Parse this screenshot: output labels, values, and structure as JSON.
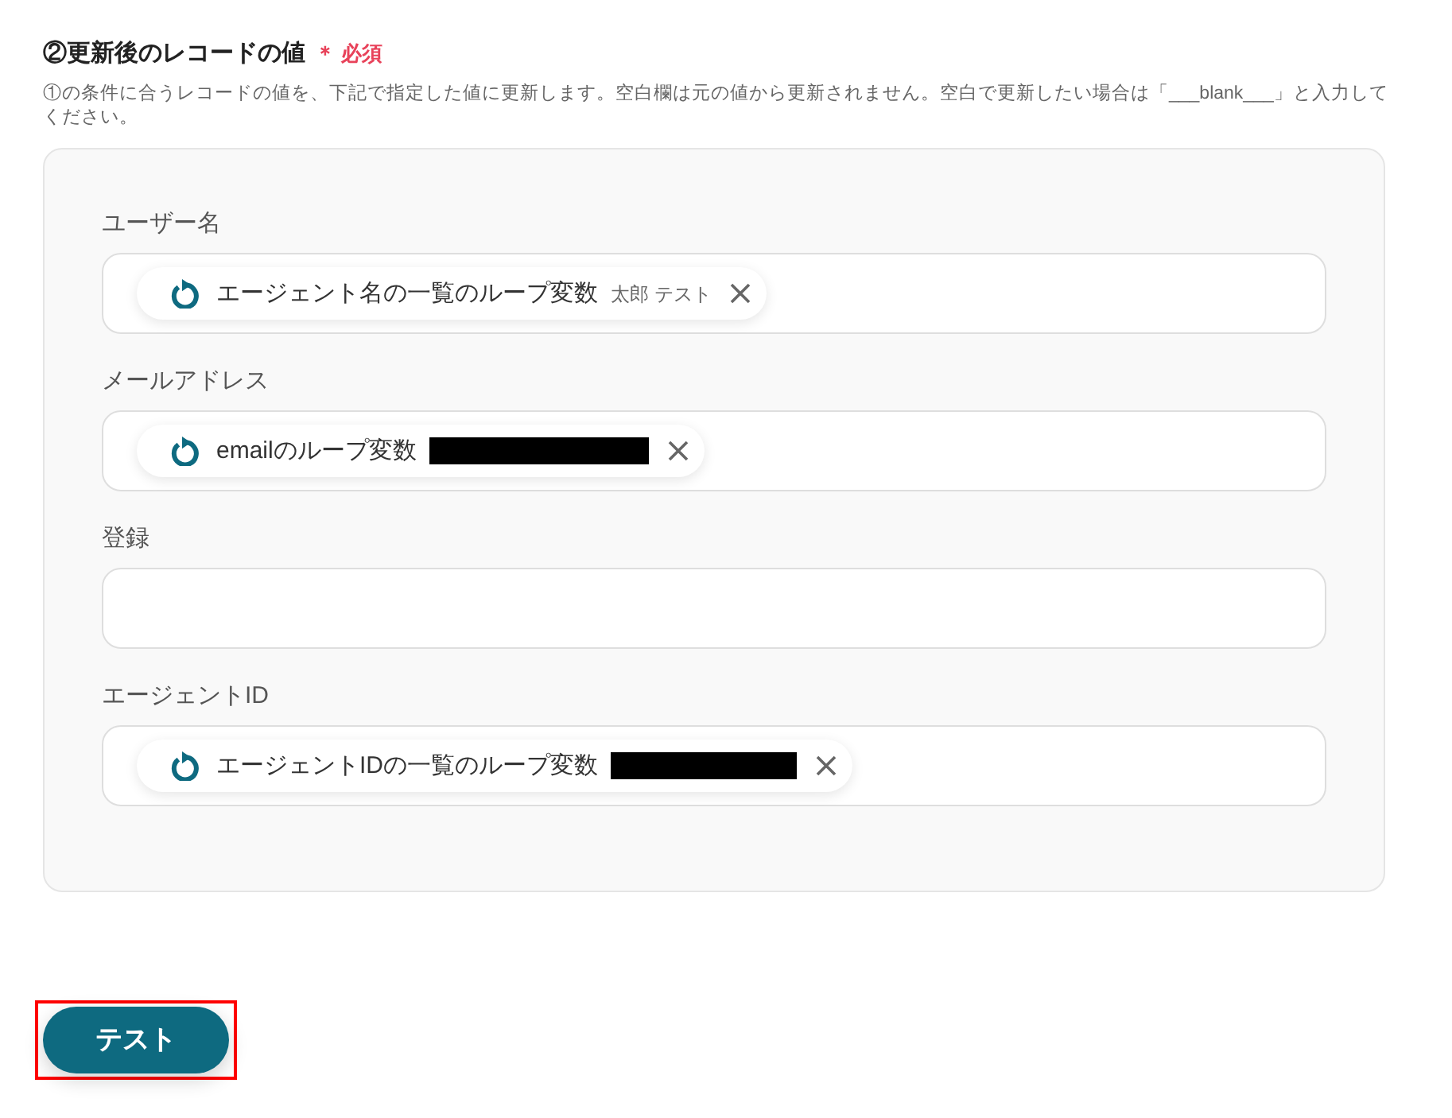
{
  "section": {
    "title": "②更新後のレコードの値",
    "required_label": "＊ 必須",
    "description": "①の条件に合うレコードの値を、下記で指定した値に更新します。空白欄は元の値から更新されません。空白で更新したい場合は「___blank___」と入力してください。"
  },
  "fields": [
    {
      "label": "ユーザー名",
      "chips": [
        {
          "name": "エージェント名の一覧のループ変数",
          "value": "太郎 テスト",
          "redacted": false
        }
      ]
    },
    {
      "label": "メールアドレス",
      "chips": [
        {
          "name": "emailのループ変数",
          "redacted": true
        }
      ]
    },
    {
      "label": "登録"
    },
    {
      "label": "エージェントID",
      "chips": [
        {
          "name": "エージェントIDの一覧のループ変数",
          "redacted": true
        }
      ]
    }
  ],
  "test_button": {
    "label": "テスト",
    "highlighted": true
  }
}
